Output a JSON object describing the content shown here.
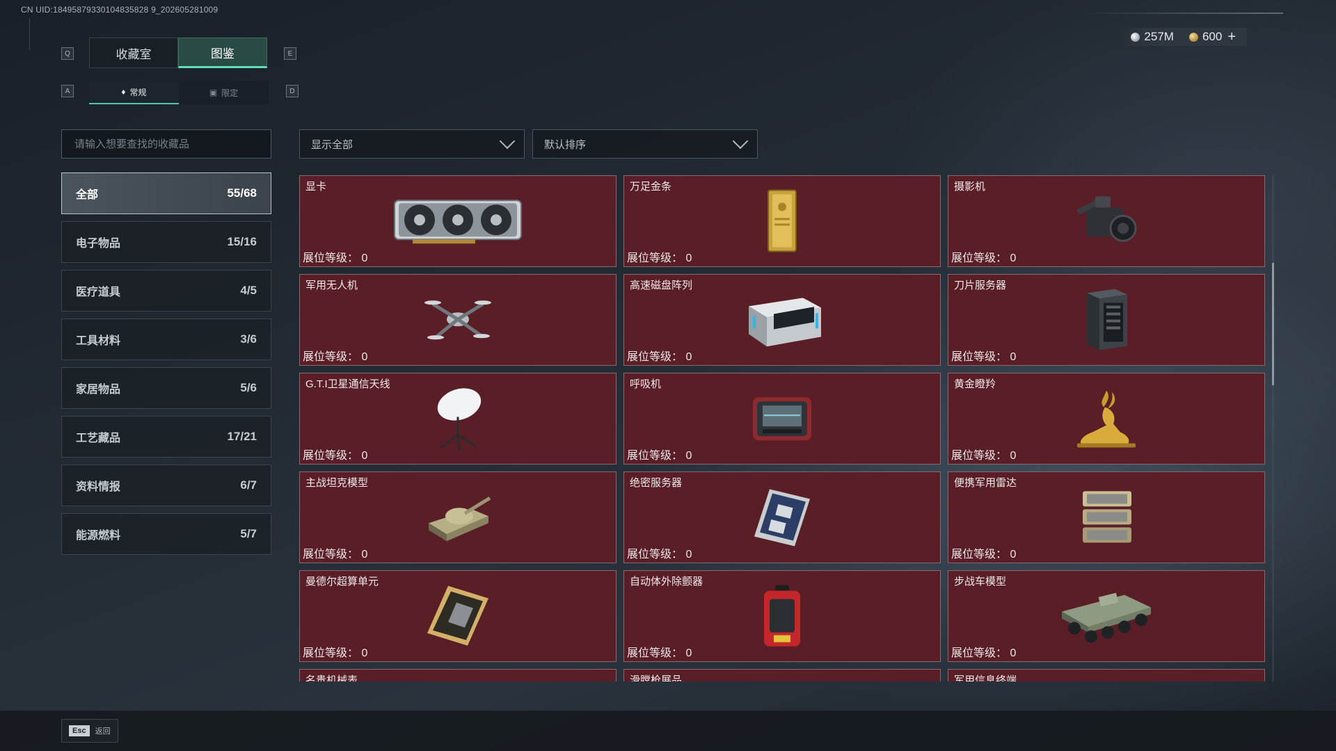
{
  "uid_text": "CN UID:18495879330104835828 9_202605281009",
  "currency": {
    "silver": "257M",
    "gold": "600",
    "add": "+"
  },
  "keys": {
    "prev_tab": "Q",
    "next_tab": "E",
    "prev_sub": "A",
    "next_sub": "D"
  },
  "tabs": [
    {
      "label": "收藏室",
      "active": false
    },
    {
      "label": "图鉴",
      "active": true
    }
  ],
  "subtabs": [
    {
      "label": "常规",
      "icon": "flame-icon",
      "active": true
    },
    {
      "label": "限定",
      "icon": "image-icon",
      "active": false
    }
  ],
  "search": {
    "placeholder": "请输入想要查找的收藏品"
  },
  "filters": {
    "show": "显示全部",
    "sort": "默认排序"
  },
  "categories": [
    {
      "name": "全部",
      "count": "55/68",
      "active": true
    },
    {
      "name": "电子物品",
      "count": "15/16"
    },
    {
      "name": "医疗道具",
      "count": "4/5"
    },
    {
      "name": "工具材料",
      "count": "3/6"
    },
    {
      "name": "家居物品",
      "count": "5/6"
    },
    {
      "name": "工艺藏品",
      "count": "17/21"
    },
    {
      "name": "资料情报",
      "count": "6/7"
    },
    {
      "name": "能源燃料",
      "count": "5/7"
    }
  ],
  "level_label": "展位等级：",
  "items": [
    {
      "name": "显卡",
      "level": "0",
      "icon": "graphics-card-icon"
    },
    {
      "name": "万足金条",
      "level": "0",
      "icon": "gold-bar-icon"
    },
    {
      "name": "摄影机",
      "level": "0",
      "icon": "video-camera-icon"
    },
    {
      "name": "军用无人机",
      "level": "0",
      "icon": "drone-icon"
    },
    {
      "name": "高速磁盘阵列",
      "level": "0",
      "icon": "disk-array-icon"
    },
    {
      "name": "刀片服务器",
      "level": "0",
      "icon": "blade-server-icon"
    },
    {
      "name": "G.T.I卫星通信天线",
      "level": "0",
      "icon": "satellite-dish-icon"
    },
    {
      "name": "呼吸机",
      "level": "0",
      "icon": "ventilator-icon"
    },
    {
      "name": "黄金瞪羚",
      "level": "0",
      "icon": "golden-gazelle-icon"
    },
    {
      "name": "主战坦克模型",
      "level": "0",
      "icon": "tank-model-icon"
    },
    {
      "name": "绝密服务器",
      "level": "0",
      "icon": "secret-server-icon"
    },
    {
      "name": "便携军用雷达",
      "level": "0",
      "icon": "radar-icon"
    },
    {
      "name": "曼德尔超算单元",
      "level": "0",
      "icon": "supercomputer-chip-icon"
    },
    {
      "name": "自动体外除颤器",
      "level": "0",
      "icon": "defibrillator-icon"
    },
    {
      "name": "步战车模型",
      "level": "0",
      "icon": "ifv-model-icon"
    },
    {
      "name": "名贵机械表",
      "level": "",
      "icon": "watch-icon"
    },
    {
      "name": "滑膛枪展品",
      "level": "",
      "icon": "musket-icon"
    },
    {
      "name": "军用信息终端",
      "level": "",
      "icon": "terminal-icon"
    }
  ],
  "esc": {
    "key": "Esc",
    "label": "返回"
  }
}
